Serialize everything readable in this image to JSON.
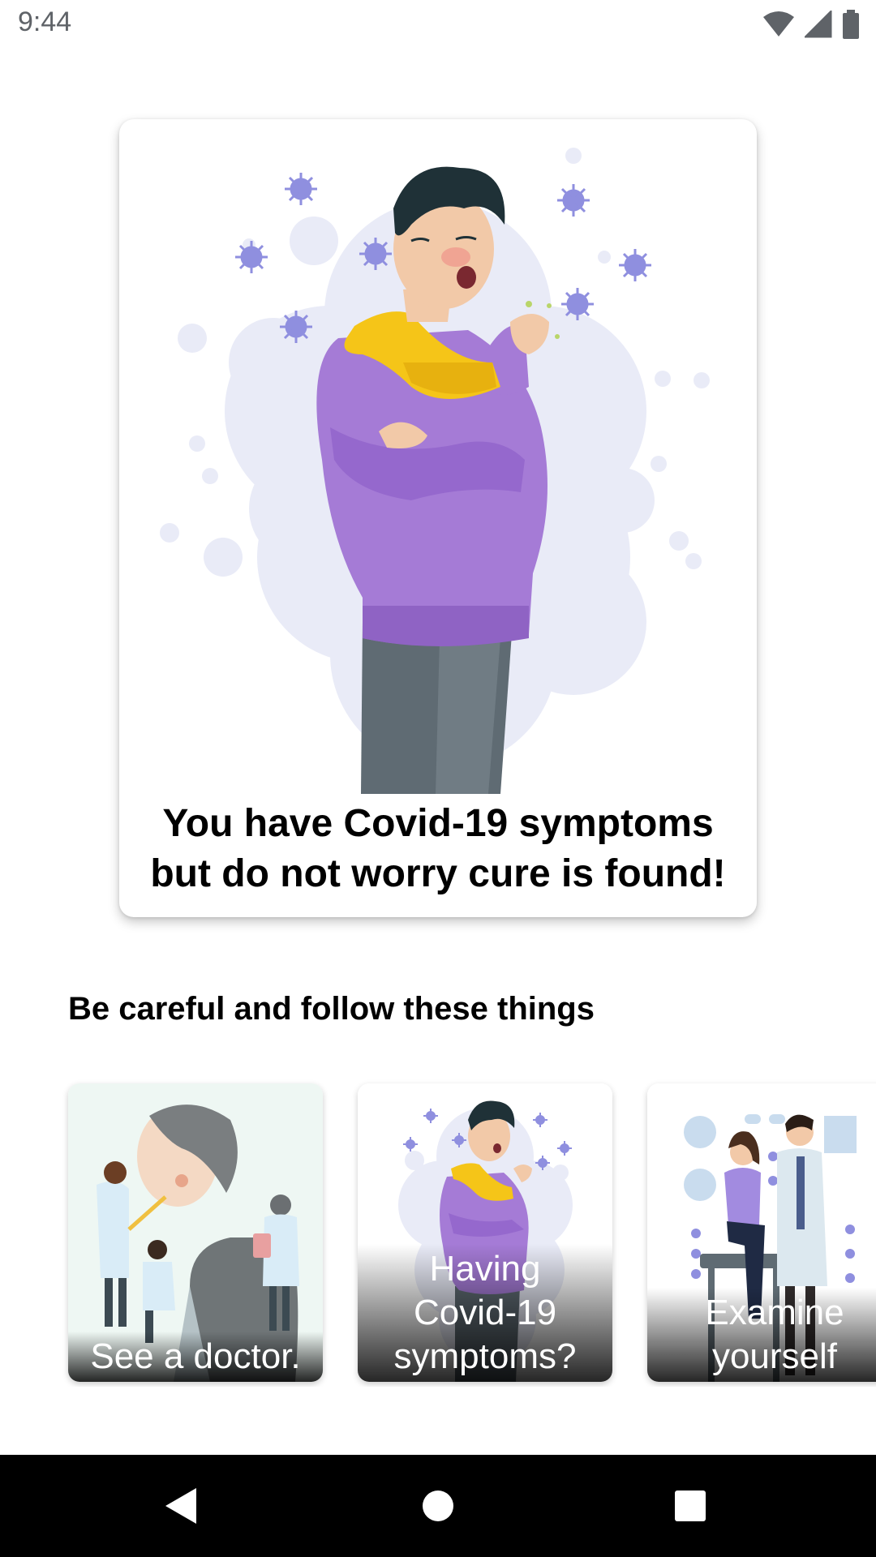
{
  "status_bar": {
    "time": "9:44",
    "icons": [
      "wifi-icon",
      "signal-icon",
      "battery-icon"
    ]
  },
  "hero": {
    "illustration": "sick-man-coughing-illustration",
    "caption": "You have Covid-19 symptoms\nbut do not worry cure is found!"
  },
  "section": {
    "title": "Be careful and follow these things"
  },
  "tips": [
    {
      "label": "See a doctor.",
      "illustration": "doctors-examining-patient-illustration"
    },
    {
      "label": "Having\nCovid-19\nsymptoms?",
      "illustration": "sick-man-coughing-illustration"
    },
    {
      "label": "Examine\nyourself",
      "illustration": "doctor-and-patient-illustration"
    }
  ],
  "nav_bar": {
    "icons": [
      "back-icon",
      "home-icon",
      "recents-icon"
    ]
  },
  "colors": {
    "sweater": "#a57bd6",
    "scarf": "#f5c518",
    "virus": "#8f8fdf",
    "bubble": "#e9ebf7",
    "pants": "#5f6b73"
  }
}
